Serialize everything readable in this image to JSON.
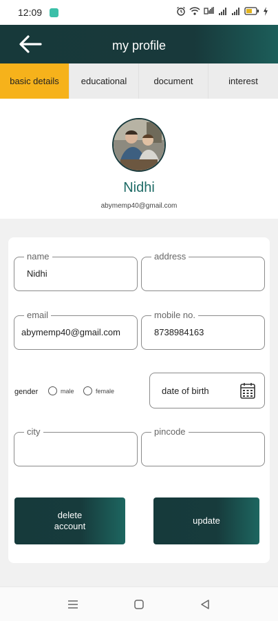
{
  "status_bar": {
    "time": "12:09",
    "icons": [
      "alarm-icon",
      "wifi-icon",
      "volte-icon",
      "signal-icon",
      "signal-icon",
      "battery-icon",
      "charging-icon"
    ]
  },
  "header": {
    "title": "my profile",
    "back_icon": "arrow-left-icon"
  },
  "tabs": [
    {
      "label": "basic details",
      "active": true
    },
    {
      "label": "educational",
      "active": false
    },
    {
      "label": "document",
      "active": false
    },
    {
      "label": "interest",
      "active": false
    }
  ],
  "profile": {
    "name": "Nidhi",
    "email": "abymemp40@gmail.com"
  },
  "form": {
    "name": {
      "label": "name",
      "value": "Nidhi"
    },
    "address": {
      "label": "address",
      "value": ""
    },
    "email": {
      "label": "email",
      "value": "abymemp40@gmail.com"
    },
    "mobile": {
      "label": "mobile no.",
      "value": "8738984163"
    },
    "gender": {
      "label": "gender",
      "options": [
        "male",
        "female"
      ],
      "selected": null
    },
    "dob": {
      "label": "date of birth",
      "icon": "calendar-icon"
    },
    "city": {
      "label": "city",
      "value": ""
    },
    "pincode": {
      "label": "pincode",
      "value": ""
    }
  },
  "buttons": {
    "delete_line1": "delete",
    "delete_line2": "account",
    "update": "update"
  },
  "nav": {
    "icons": [
      "menu-icon",
      "home-square-icon",
      "back-triangle-icon"
    ]
  },
  "colors": {
    "header": "#18393b",
    "accent_tab": "#f6b21b",
    "name_text": "#1e6b66"
  }
}
